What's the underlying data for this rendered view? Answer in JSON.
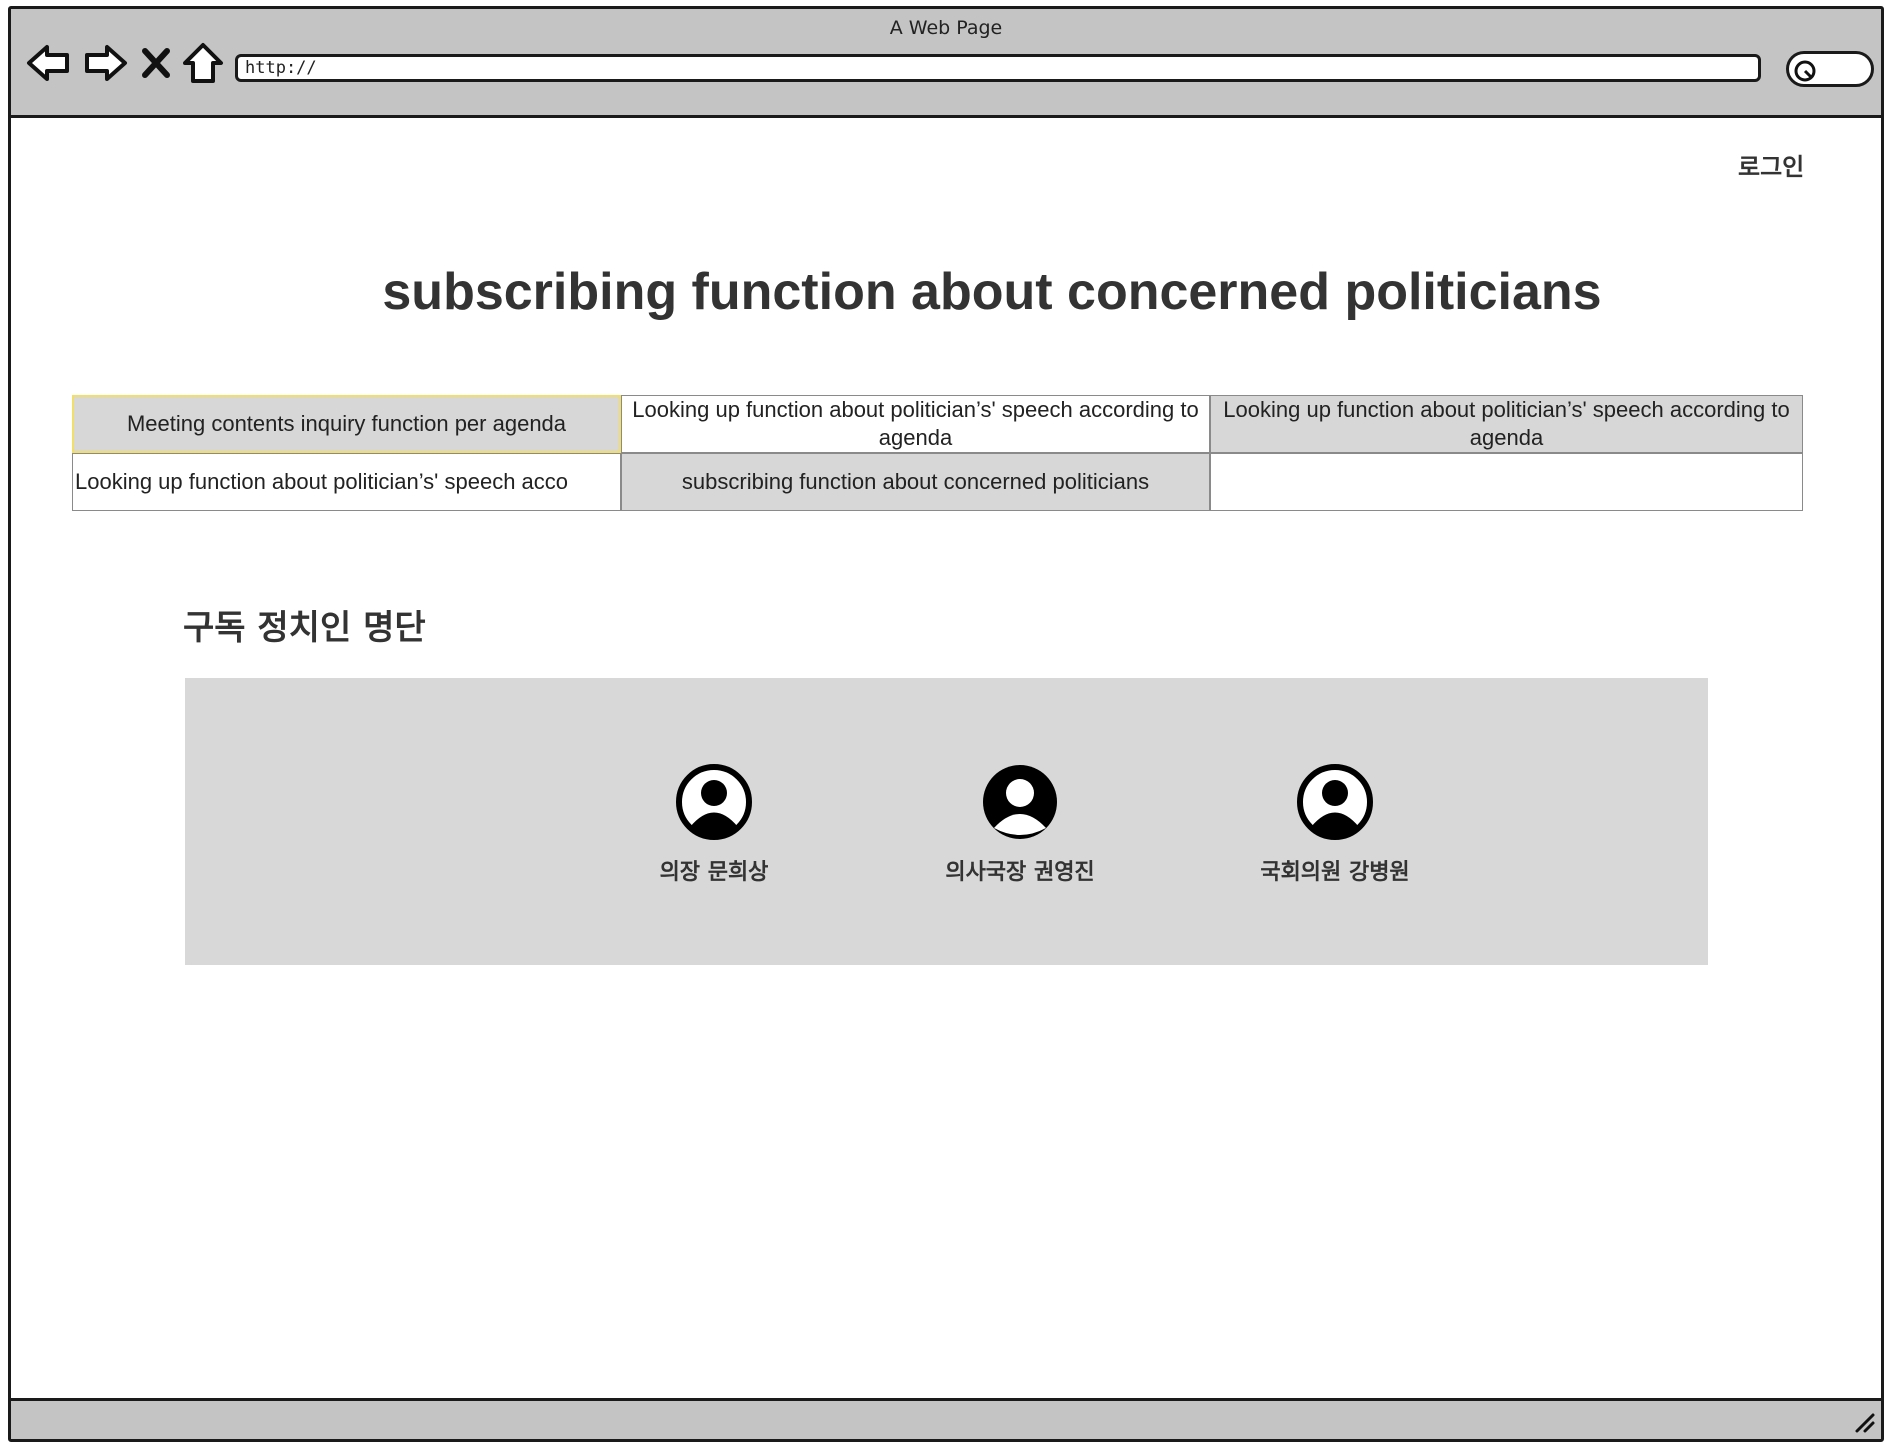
{
  "browser": {
    "window_title": "A Web Page",
    "url": "http://"
  },
  "header": {
    "login_label": "로그인"
  },
  "page": {
    "title": "subscribing function about concerned politicians"
  },
  "menu": {
    "items": [
      {
        "label": "Meeting contents inquiry function per agenda",
        "active": true
      },
      {
        "label": "Looking up  function about politician’s' speech according to agenda"
      },
      {
        "label": "Looking up  function about politician’s' speech according to agenda"
      },
      {
        "label": "Looking up  function about politician’s' speech acco"
      },
      {
        "label": "subscribing function about concerned politicians"
      },
      {
        "label": ""
      }
    ]
  },
  "subscriptions": {
    "heading": "구독 정치인 명단",
    "politicians": [
      {
        "name": "의장 문희상",
        "icon": "user-avatar-icon"
      },
      {
        "name": "의사국장 권영진",
        "icon": "user-avatar-icon"
      },
      {
        "name": "국회의원 강병원",
        "icon": "user-avatar-icon"
      }
    ]
  }
}
